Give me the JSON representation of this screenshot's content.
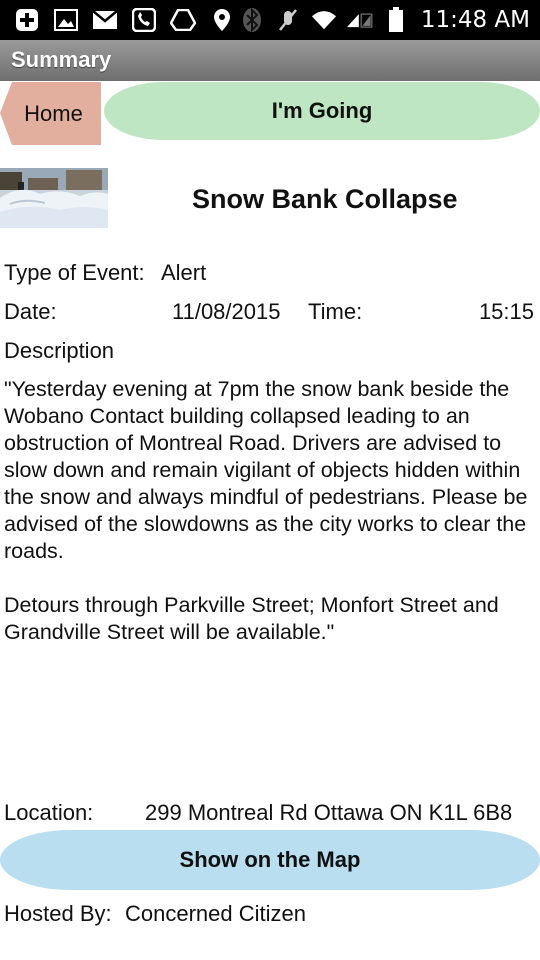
{
  "status_bar": {
    "time": "11:48 AM",
    "icons": [
      "plus-box-icon",
      "image-icon",
      "mail-icon",
      "voicemail-icon",
      "drive-icon",
      "location-pin-icon",
      "bluetooth-icon",
      "mute-icon",
      "wifi-icon",
      "signal-icon",
      "battery-icon"
    ]
  },
  "header": {
    "title": "Summary"
  },
  "actions": {
    "home_label": "Home",
    "going_label": "I'm Going"
  },
  "event": {
    "title": "Snow Bank Collapse",
    "type_label": "Type of Event:",
    "type_value": "Alert",
    "date_label": "Date:",
    "date_value": "11/08/2015",
    "time_label": "Time:",
    "time_value": "15:15",
    "description_label": "Description",
    "description": "\"Yesterday evening at 7pm the snow bank beside the Wobano Contact building collapsed leading to an obstruction of Montreal Road. Drivers are advised to slow down and remain vigilant of objects hidden within the snow and always mindful of pedestrians. Please be advised of the slowdowns as the city works to clear the roads.\n\nDetours through Parkville Street; Monfort Street and Grandville Street will be available.\"",
    "location_label": "Location:",
    "location_value": "299 Montreal Rd Ottawa ON K1L 6B8",
    "map_button_label": "Show on the Map",
    "host_label": "Hosted By:",
    "host_value": "Concerned Citizen"
  }
}
